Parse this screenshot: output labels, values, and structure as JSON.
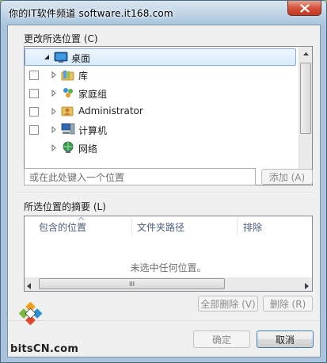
{
  "window": {
    "title": "你的IT软件频道 software.it168.com"
  },
  "change_section": {
    "label": "更改所选位置 (C)",
    "tree_items": [
      {
        "label": "桌面",
        "icon": "desktop-icon",
        "checkbox": false,
        "expanded": true
      },
      {
        "label": "库",
        "icon": "library-icon",
        "checkbox": true,
        "expanded": false
      },
      {
        "label": "家庭组",
        "icon": "homegroup-icon",
        "checkbox": true,
        "expanded": false
      },
      {
        "label": "Administrator",
        "icon": "user-folder-icon",
        "checkbox": true,
        "expanded": false
      },
      {
        "label": "计算机",
        "icon": "computer-icon",
        "checkbox": true,
        "expanded": false
      },
      {
        "label": "网络",
        "icon": "network-icon",
        "checkbox": false,
        "expanded": false
      }
    ],
    "location_placeholder": "或在此处键入一个位置",
    "add_button": "添加 (A)"
  },
  "summary_section": {
    "label": "所选位置的摘要 (L)",
    "columns": [
      "包含的位置",
      "文件夹路径",
      "排除"
    ],
    "empty_message": "未选中任何位置。",
    "scroll_grip": "III",
    "delete_all_button": "全部删除 (V)",
    "delete_button": "删除 (R)"
  },
  "footer": {
    "ok_button": "确定",
    "cancel_button": "取消"
  },
  "watermark": {
    "text": "bitsCN.com"
  },
  "colors": {
    "selection": "#d8ebfb",
    "close_button": "#c0391f",
    "title_glass": "#a9c4dc"
  }
}
